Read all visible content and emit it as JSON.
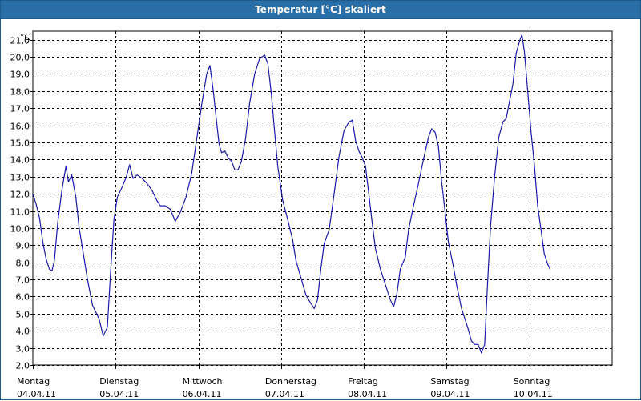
{
  "window": {
    "title": "Temperatur [°C] skaliert"
  },
  "chart_data": {
    "type": "line",
    "title": "Temperatur [°C] skaliert",
    "ylabel": "°C",
    "ylim": [
      2.0,
      21.5
    ],
    "yticks": [
      "2,0",
      "3,0",
      "4,0",
      "5,0",
      "6,0",
      "7,0",
      "8,0",
      "9,0",
      "10,0",
      "11,0",
      "12,0",
      "13,0",
      "14,0",
      "15,0",
      "16,0",
      "17,0",
      "18,0",
      "19,0",
      "20,0",
      "21,0"
    ],
    "xlim": [
      0,
      7
    ],
    "xticks": [
      {
        "day": "Montag",
        "date": "04.04.11"
      },
      {
        "day": "Dienstag",
        "date": "05.04.11"
      },
      {
        "day": "Mittwoch",
        "date": "06.04.11"
      },
      {
        "day": "Donnerstag",
        "date": "07.04.11"
      },
      {
        "day": "Freitag",
        "date": "08.04.11"
      },
      {
        "day": "Samstag",
        "date": "09.04.11"
      },
      {
        "day": "Sonntag",
        "date": "10.04.11"
      }
    ],
    "grid": true,
    "color": "#1a1aa8",
    "series": [
      {
        "points": [
          [
            0.0,
            12.0
          ],
          [
            0.04,
            11.4
          ],
          [
            0.08,
            10.6
          ],
          [
            0.12,
            9.2
          ],
          [
            0.16,
            8.2
          ],
          [
            0.2,
            7.6
          ],
          [
            0.23,
            7.5
          ],
          [
            0.26,
            8.1
          ],
          [
            0.3,
            10.3
          ],
          [
            0.35,
            12.2
          ],
          [
            0.4,
            13.6
          ],
          [
            0.43,
            12.7
          ],
          [
            0.47,
            13.1
          ],
          [
            0.52,
            11.8
          ],
          [
            0.56,
            10.0
          ],
          [
            0.6,
            8.8
          ],
          [
            0.66,
            7.0
          ],
          [
            0.72,
            5.5
          ],
          [
            0.75,
            5.2
          ],
          [
            0.8,
            4.7
          ],
          [
            0.85,
            3.7
          ],
          [
            0.9,
            4.2
          ],
          [
            0.94,
            7.5
          ],
          [
            0.98,
            10.5
          ],
          [
            1.02,
            11.8
          ],
          [
            1.08,
            12.4
          ],
          [
            1.13,
            13.0
          ],
          [
            1.17,
            13.7
          ],
          [
            1.21,
            12.9
          ],
          [
            1.26,
            13.1
          ],
          [
            1.32,
            12.9
          ],
          [
            1.38,
            12.6
          ],
          [
            1.44,
            12.2
          ],
          [
            1.5,
            11.6
          ],
          [
            1.54,
            11.3
          ],
          [
            1.6,
            11.3
          ],
          [
            1.66,
            11.1
          ],
          [
            1.72,
            10.4
          ],
          [
            1.78,
            10.9
          ],
          [
            1.85,
            11.8
          ],
          [
            1.92,
            13.2
          ],
          [
            1.98,
            15.2
          ],
          [
            2.04,
            17.2
          ],
          [
            2.1,
            19.0
          ],
          [
            2.14,
            19.5
          ],
          [
            2.18,
            18.0
          ],
          [
            2.22,
            16.2
          ],
          [
            2.25,
            14.9
          ],
          [
            2.28,
            14.4
          ],
          [
            2.32,
            14.5
          ],
          [
            2.36,
            14.1
          ],
          [
            2.4,
            13.9
          ],
          [
            2.44,
            13.4
          ],
          [
            2.48,
            13.4
          ],
          [
            2.52,
            13.9
          ],
          [
            2.57,
            15.2
          ],
          [
            2.62,
            17.3
          ],
          [
            2.68,
            19.0
          ],
          [
            2.74,
            19.9
          ],
          [
            2.8,
            20.1
          ],
          [
            2.84,
            19.6
          ],
          [
            2.88,
            17.9
          ],
          [
            2.92,
            15.7
          ],
          [
            2.96,
            13.6
          ],
          [
            3.02,
            11.6
          ],
          [
            3.08,
            10.5
          ],
          [
            3.14,
            9.3
          ],
          [
            3.18,
            8.1
          ],
          [
            3.24,
            7.1
          ],
          [
            3.3,
            6.1
          ],
          [
            3.36,
            5.6
          ],
          [
            3.4,
            5.3
          ],
          [
            3.44,
            5.8
          ],
          [
            3.48,
            7.6
          ],
          [
            3.52,
            9.1
          ],
          [
            3.58,
            9.9
          ],
          [
            3.64,
            12.0
          ],
          [
            3.7,
            14.2
          ],
          [
            3.76,
            15.7
          ],
          [
            3.82,
            16.2
          ],
          [
            3.86,
            16.3
          ],
          [
            3.9,
            15.1
          ],
          [
            3.94,
            14.5
          ],
          [
            3.98,
            14.1
          ],
          [
            4.02,
            13.6
          ],
          [
            4.06,
            12.0
          ],
          [
            4.1,
            10.3
          ],
          [
            4.14,
            8.8
          ],
          [
            4.2,
            7.6
          ],
          [
            4.26,
            6.7
          ],
          [
            4.32,
            5.8
          ],
          [
            4.36,
            5.4
          ],
          [
            4.4,
            6.2
          ],
          [
            4.44,
            7.6
          ],
          [
            4.5,
            8.3
          ],
          [
            4.54,
            9.9
          ],
          [
            4.6,
            11.3
          ],
          [
            4.66,
            12.6
          ],
          [
            4.72,
            14.0
          ],
          [
            4.78,
            15.3
          ],
          [
            4.82,
            15.8
          ],
          [
            4.86,
            15.6
          ],
          [
            4.9,
            14.8
          ],
          [
            4.94,
            12.7
          ],
          [
            4.98,
            11.0
          ],
          [
            5.02,
            9.2
          ],
          [
            5.08,
            7.8
          ],
          [
            5.12,
            6.7
          ],
          [
            5.18,
            5.3
          ],
          [
            5.22,
            4.7
          ],
          [
            5.26,
            4.1
          ],
          [
            5.3,
            3.4
          ],
          [
            5.34,
            3.2
          ],
          [
            5.38,
            3.2
          ],
          [
            5.42,
            2.7
          ],
          [
            5.46,
            3.2
          ],
          [
            5.49,
            6.3
          ],
          [
            5.53,
            10.1
          ],
          [
            5.58,
            13.0
          ],
          [
            5.63,
            15.3
          ],
          [
            5.68,
            16.2
          ],
          [
            5.72,
            16.4
          ],
          [
            5.76,
            17.4
          ],
          [
            5.8,
            18.4
          ],
          [
            5.84,
            20.2
          ],
          [
            5.88,
            20.9
          ],
          [
            5.91,
            21.3
          ],
          [
            5.94,
            20.3
          ],
          [
            5.98,
            18.0
          ],
          [
            6.02,
            15.6
          ],
          [
            6.06,
            13.7
          ],
          [
            6.1,
            11.3
          ],
          [
            6.14,
            9.9
          ],
          [
            6.18,
            8.5
          ],
          [
            6.22,
            7.9
          ],
          [
            6.25,
            7.6
          ]
        ]
      }
    ]
  }
}
